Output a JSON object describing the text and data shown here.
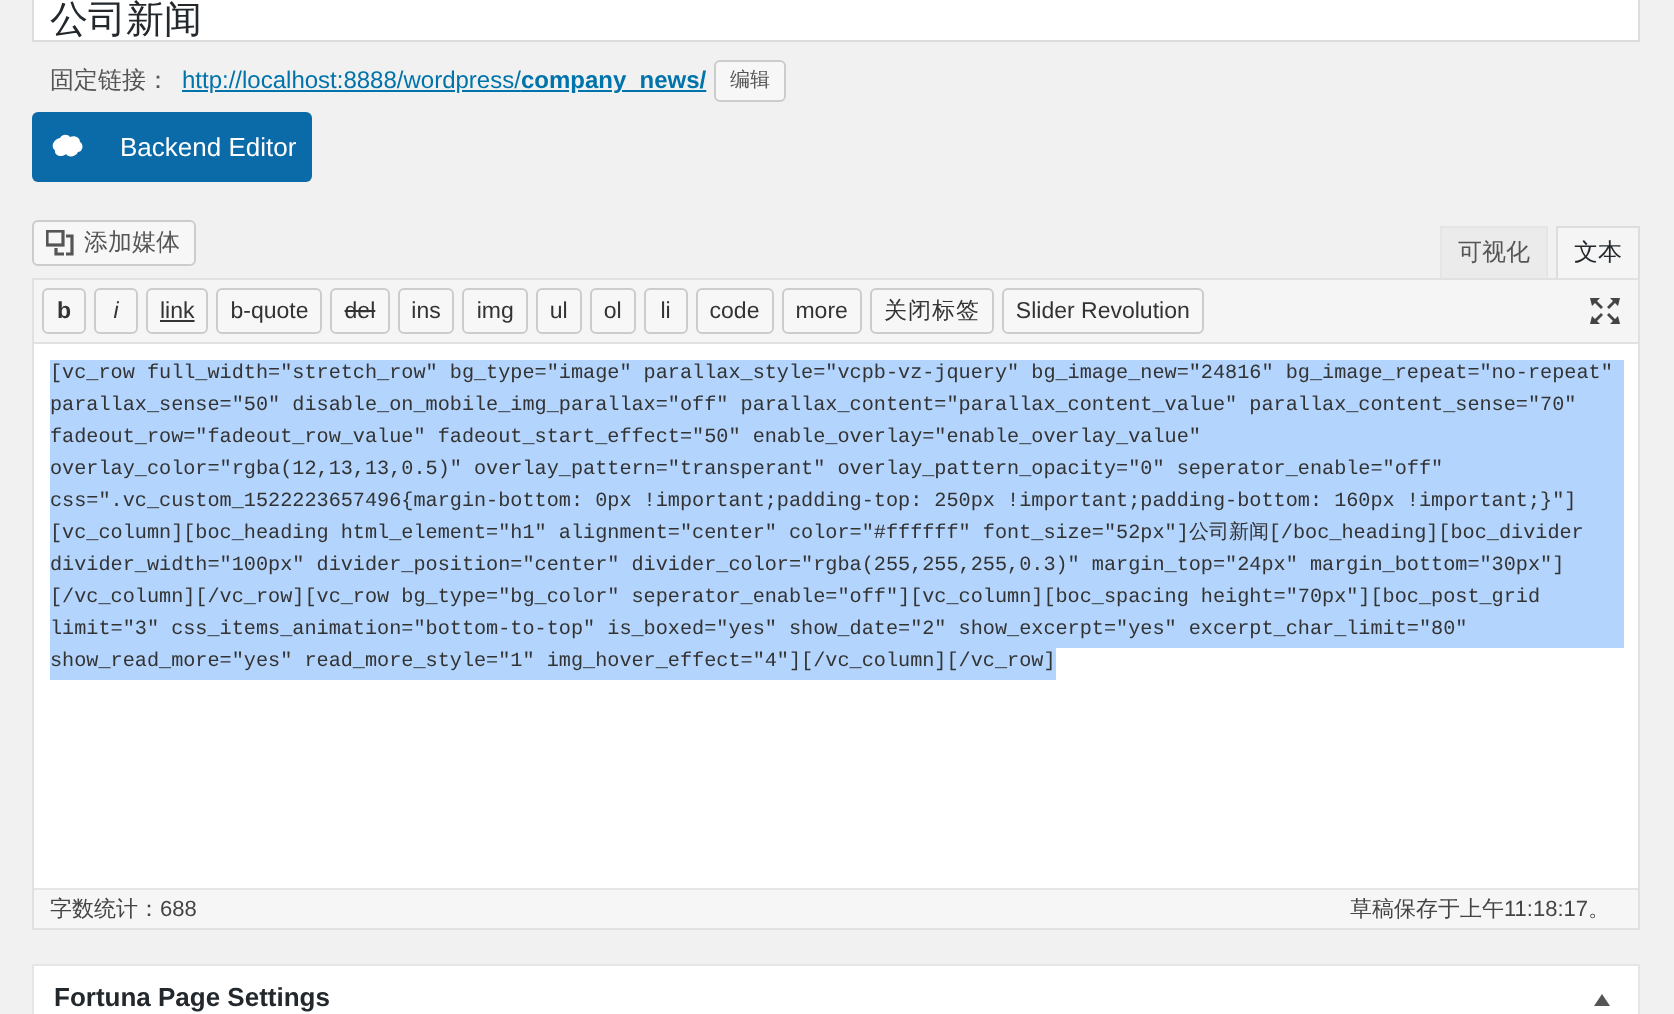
{
  "title_field": {
    "value": "公司新闻"
  },
  "permalink": {
    "label": "固定链接：",
    "url_base": "http://localhost:8888/wordpress/",
    "url_slug": "company_news/",
    "edit_button": "编辑"
  },
  "backend_editor_button": "Backend Editor",
  "add_media_button": "添加媒体",
  "editor_tabs": [
    {
      "label": "可视化",
      "selected": false
    },
    {
      "label": "文本",
      "selected": true
    }
  ],
  "toolbar": [
    {
      "label": "b",
      "kind": "bold"
    },
    {
      "label": "i",
      "kind": "italic"
    },
    {
      "label": "link",
      "kind": "underline"
    },
    {
      "label": "b-quote",
      "kind": "plain"
    },
    {
      "label": "del",
      "kind": "strike"
    },
    {
      "label": "ins",
      "kind": "plain"
    },
    {
      "label": "img",
      "kind": "plain"
    },
    {
      "label": "ul",
      "kind": "plain"
    },
    {
      "label": "ol",
      "kind": "plain"
    },
    {
      "label": "li",
      "kind": "plain"
    },
    {
      "label": "code",
      "kind": "plain"
    },
    {
      "label": "more",
      "kind": "plain"
    },
    {
      "label": "关闭标签",
      "kind": "plain"
    },
    {
      "label": "Slider Revolution",
      "kind": "plain"
    }
  ],
  "content_lines": [
    "[vc_row full_width=\"stretch_row\" bg_type=\"image\" parallax_style=\"vcpb-vz-jquery\" bg_image_new=\"24816\" bg_image_repeat=\"no-repeat\"",
    "parallax_sense=\"50\" disable_on_mobile_img_parallax=\"off\" parallax_content=\"parallax_content_value\" parallax_content_sense=\"70\"",
    "fadeout_row=\"fadeout_row_value\" fadeout_start_effect=\"50\" enable_overlay=\"enable_overlay_value\"",
    "overlay_color=\"rgba(12,13,13,0.5)\" overlay_pattern=\"transperant\" overlay_pattern_opacity=\"0\" seperator_enable=\"off\"",
    "css=\".vc_custom_1522223657496{margin-bottom: 0px !important;padding-top: 250px !important;padding-bottom: 160px !important;}\"]",
    "[vc_column][boc_heading html_element=\"h1\" alignment=\"center\" color=\"#ffffff\" font_size=\"52px\"]公司新闻[/boc_heading][boc_divider",
    "divider_width=\"100px\" divider_position=\"center\" divider_color=\"rgba(255,255,255,0.3)\" margin_top=\"24px\" margin_bottom=\"30px\"]",
    "[/vc_column][/vc_row][vc_row bg_type=\"bg_color\" seperator_enable=\"off\"][vc_column][boc_spacing height=\"70px\"][boc_post_grid",
    "limit=\"3\" css_items_animation=\"bottom-to-top\" is_boxed=\"yes\" show_date=\"2\" show_excerpt=\"yes\" excerpt_char_limit=\"80\"",
    "show_read_more=\"yes\" read_more_style=\"1\" img_hover_effect=\"4\"][/vc_column][/vc_row]"
  ],
  "status_bar": {
    "word_count": "字数统计：688",
    "saved": "草稿保存于上午11:18:17。"
  },
  "panel": {
    "title": "Fortuna Page Settings",
    "expanded": true
  }
}
